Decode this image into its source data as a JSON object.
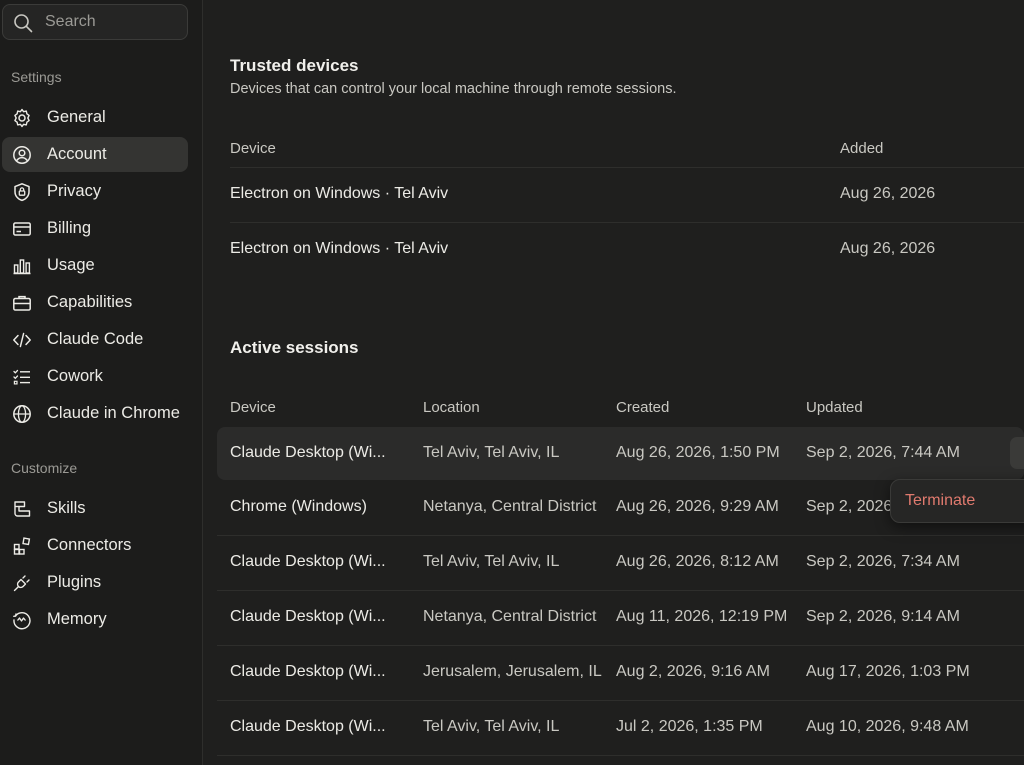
{
  "search": {
    "placeholder": "Search"
  },
  "sidebar": {
    "settings_label": "Settings",
    "customize_label": "Customize",
    "settings_items": [
      {
        "label": "General",
        "icon": "gear-icon"
      },
      {
        "label": "Account",
        "icon": "user-circle-icon",
        "active": true
      },
      {
        "label": "Privacy",
        "icon": "shield-lock-icon"
      },
      {
        "label": "Billing",
        "icon": "credit-card-icon"
      },
      {
        "label": "Usage",
        "icon": "bar-chart-icon"
      },
      {
        "label": "Capabilities",
        "icon": "briefcase-icon"
      },
      {
        "label": "Claude Code",
        "icon": "code-icon"
      },
      {
        "label": "Cowork",
        "icon": "checklist-icon"
      },
      {
        "label": "Claude in Chrome",
        "icon": "globe-icon"
      }
    ],
    "customize_items": [
      {
        "label": "Skills",
        "icon": "skills-icon"
      },
      {
        "label": "Connectors",
        "icon": "connectors-icon"
      },
      {
        "label": "Plugins",
        "icon": "plug-icon"
      },
      {
        "label": "Memory",
        "icon": "memory-icon"
      }
    ]
  },
  "trusted": {
    "title": "Trusted devices",
    "subtitle": "Devices that can control your local machine through remote sessions.",
    "col_device": "Device",
    "col_added": "Added",
    "rows": [
      {
        "device": "Electron on Windows · Tel Aviv",
        "added": "Aug 26, 2026"
      },
      {
        "device": "Electron on Windows · Tel Aviv",
        "added": "Aug 26, 2026"
      }
    ]
  },
  "sessions": {
    "title": "Active sessions",
    "col_device": "Device",
    "col_location": "Location",
    "col_created": "Created",
    "col_updated": "Updated",
    "rows": [
      {
        "device": "Claude Desktop (Wi...",
        "location": "Tel Aviv, Tel Aviv, IL",
        "created": "Aug 26, 2026, 1:50 PM",
        "updated": "Sep 2, 2026, 7:44 AM"
      },
      {
        "device": "Chrome (Windows)",
        "location": "Netanya, Central District",
        "created": "Aug 26, 2026, 9:29 AM",
        "updated": "Sep 2, 2026"
      },
      {
        "device": "Claude Desktop (Wi...",
        "location": "Tel Aviv, Tel Aviv, IL",
        "created": "Aug 26, 2026, 8:12 AM",
        "updated": "Sep 2, 2026, 7:34 AM"
      },
      {
        "device": "Claude Desktop (Wi...",
        "location": "Netanya, Central District",
        "created": "Aug 11, 2026, 12:19 PM",
        "updated": "Sep 2, 2026, 9:14 AM"
      },
      {
        "device": "Claude Desktop (Wi...",
        "location": "Jerusalem, Jerusalem, IL",
        "created": "Aug 2, 2026, 9:16 AM",
        "updated": "Aug 17, 2026, 1:03 PM"
      },
      {
        "device": "Claude Desktop (Wi...",
        "location": "Tel Aviv, Tel Aviv, IL",
        "created": "Jul 2, 2026, 1:35 PM",
        "updated": "Aug 10, 2026, 9:48 AM"
      }
    ]
  },
  "menu": {
    "terminate_label": "Terminate"
  },
  "colors": {
    "accent_danger": "#e07a6e",
    "active_bg": "#343432"
  }
}
